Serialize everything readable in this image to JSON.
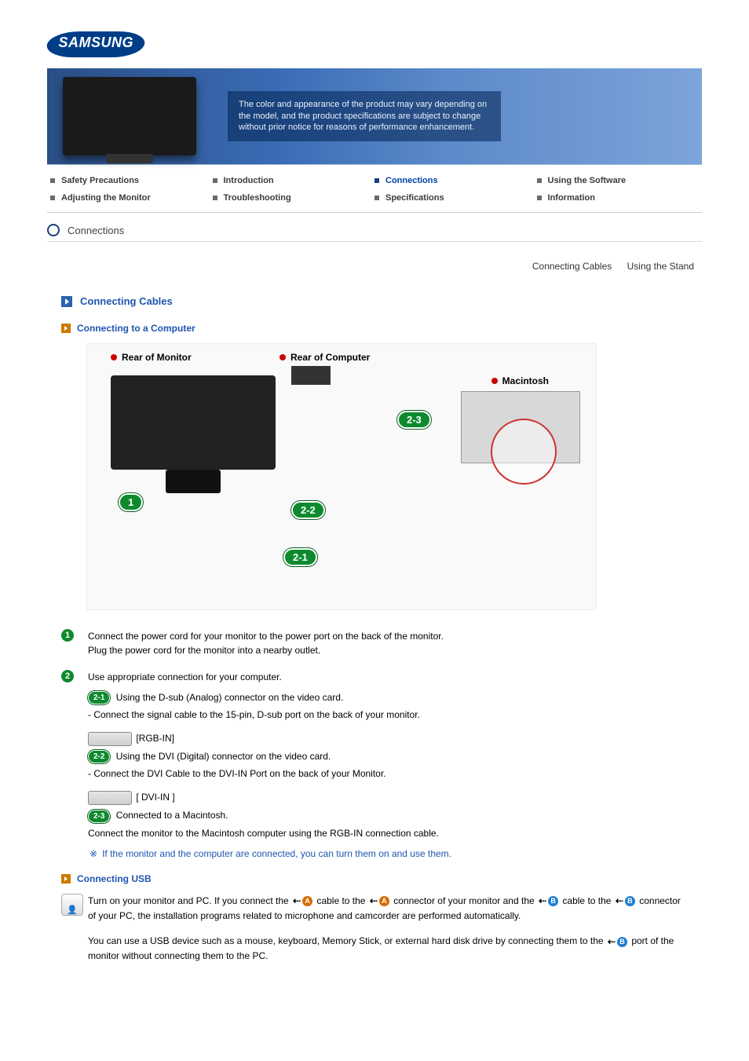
{
  "logo": "SAMSUNG",
  "banner_note": "The color and appearance of the product may vary depending on the model, and the product specifications are subject to change without prior notice for reasons of performance enhancement.",
  "nav": {
    "row1": [
      {
        "label": "Safety Precautions",
        "active": false
      },
      {
        "label": "Introduction",
        "active": false
      },
      {
        "label": "Connections",
        "active": true
      },
      {
        "label": "Using the Software",
        "active": false
      }
    ],
    "row2": [
      {
        "label": "Adjusting the Monitor",
        "active": false
      },
      {
        "label": "Troubleshooting",
        "active": false
      },
      {
        "label": "Specifications",
        "active": false
      },
      {
        "label": "Information",
        "active": false
      }
    ]
  },
  "section": "Connections",
  "subtabs": [
    "Connecting Cables",
    "Using the Stand"
  ],
  "h2": "Connecting Cables",
  "h3_computer": "Connecting to a Computer",
  "diagram": {
    "rear_monitor": "Rear of Monitor",
    "rear_computer": "Rear of Computer",
    "macintosh": "Macintosh",
    "b1": "1",
    "b21": "2-1",
    "b22": "2-2",
    "b23": "2-3"
  },
  "steps": {
    "s1": {
      "num": "1",
      "line1": "Connect the power cord for your monitor to the power port on the back of the monitor.",
      "line2": "Plug the power cord for the monitor into a nearby outlet."
    },
    "s2": {
      "num": "2",
      "line1": "Use appropriate connection for your computer."
    },
    "s21": {
      "badge": "2-1",
      "head": "Using the D-sub (Analog) connector on the video card.",
      "sub": "- Connect the signal cable to the 15-pin, D-sub port on the back of your monitor.",
      "port_label": "[RGB-IN]"
    },
    "s22": {
      "badge": "2-2",
      "head": "Using the DVI (Digital) connector on the video card.",
      "sub": "- Connect the DVI Cable to the DVI-IN Port on the back of your Monitor.",
      "port_label": "[ DVI-IN ]"
    },
    "s23": {
      "badge": "2-3",
      "head": "Connected to a Macintosh.",
      "sub": "Connect the monitor to the Macintosh computer using the RGB-IN connection cable."
    }
  },
  "note": "If the monitor and the computer are connected, you can turn them on and use them.",
  "h3_usb": "Connecting USB",
  "usb": {
    "p1a": "Turn on your monitor and PC. If you connect the ",
    "p1b": " cable to the ",
    "p1c": " connector of your monitor and the ",
    "p1d": " cable to the ",
    "p1e": " connector of your PC, the installation programs related to microphone and camcorder are performed automatically.",
    "p2a": "You can use a USB device such as a mouse, keyboard, Memory Stick, or external hard disk drive by connecting them to the ",
    "p2b": " port of the monitor without connecting them to the PC.",
    "letterA": "A",
    "letterB": "B"
  }
}
